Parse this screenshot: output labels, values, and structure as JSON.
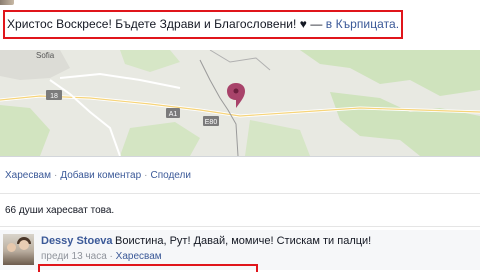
{
  "post": {
    "status_text": "Христос Воскресе! Бъдете Здрави и Благословени! ♥ — ",
    "place_link": "в Кърпицата."
  },
  "map": {
    "city_label": "Sofia",
    "road_labels": [
      "18",
      "A1",
      "E80"
    ]
  },
  "actions": {
    "like": "Харесвам",
    "comment": "Добави коментар",
    "share": "Сподели",
    "separator": "·"
  },
  "likes_summary": "66 души харесват това.",
  "comment": {
    "author": "Dessy Stoeva",
    "text": "Воистина, Рут! Давай, момиче! Стискам ти палци!",
    "time": "преди 13 часа",
    "like": "Харесвам",
    "separator": "·"
  },
  "colors": {
    "link": "#3b5998",
    "highlight": "#e0151b",
    "map_pin": "#a8436a"
  }
}
